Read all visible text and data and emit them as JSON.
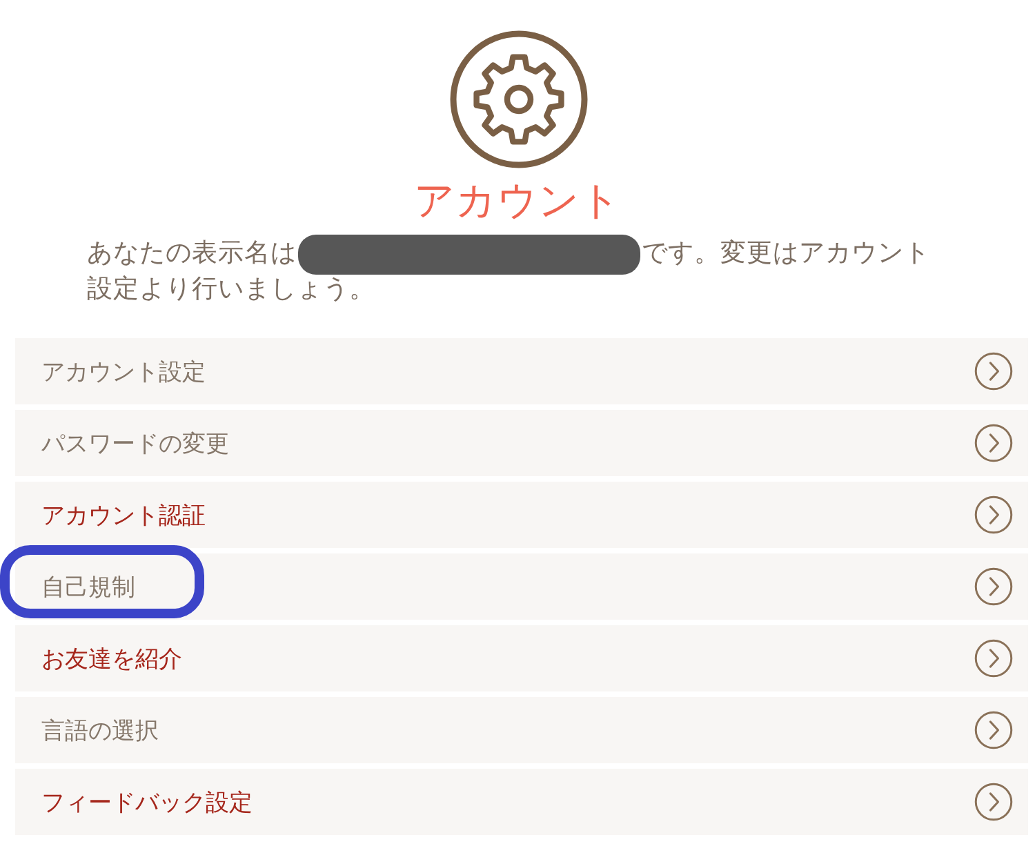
{
  "header": {
    "title": "アカウント"
  },
  "intro": {
    "line_1_before": "あなたの表示名は",
    "name_redacted": true,
    "line_1_after": "です。変更はアカウント",
    "line_2": "設定より行いましょう。"
  },
  "menu": [
    {
      "label": "アカウント設定",
      "color": "#85776a",
      "circled": false
    },
    {
      "label": "パスワードの変更",
      "color": "#85776a",
      "circled": false
    },
    {
      "label": "アカウント認証",
      "color": "#a5261b",
      "circled": false
    },
    {
      "label": "自己規制",
      "color": "#85776a",
      "circled": true
    },
    {
      "label": "お友達を紹介",
      "color": "#a5261b",
      "circled": false
    },
    {
      "label": "言語の選択",
      "color": "#85776a",
      "circled": false
    },
    {
      "label": "フィードバック設定",
      "color": "#a5261b",
      "circled": false
    }
  ]
}
